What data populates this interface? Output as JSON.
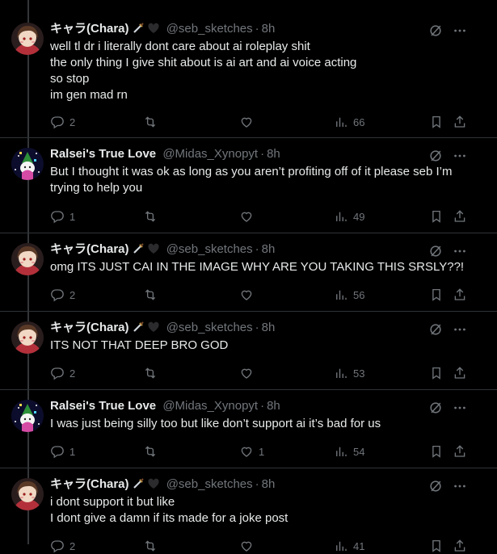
{
  "colors": {
    "background": "#000000",
    "text": "#e7e9ea",
    "muted": "#71767b",
    "divider": "#2f3336"
  },
  "tweets": [
    {
      "name": "キャラ(Chara)",
      "badges": [
        "dagger-emoji",
        "black-heart-emoji"
      ],
      "handle": "@seb_sketches",
      "dot": "·",
      "time": "8h",
      "avatar": "chara-avatar",
      "lines": [
        "well tl dr i literally dont care about ai roleplay shit",
        "the only thing I give shit about is ai art and ai voice acting",
        "so stop",
        "im gen mad rn"
      ],
      "replies": "2",
      "reposts": "",
      "likes": "",
      "views": "66"
    },
    {
      "name": "Ralsei's True Love",
      "badges": [],
      "handle": "@Midas_Xynopyt",
      "dot": "·",
      "time": "8h",
      "avatar": "ralsei-avatar",
      "lines": [
        "But I thought it was ok as long as you aren’t profiting off of it please seb I’m",
        "trying to help you"
      ],
      "replies": "1",
      "reposts": "",
      "likes": "",
      "views": "49"
    },
    {
      "name": "キャラ(Chara)",
      "badges": [
        "dagger-emoji",
        "black-heart-emoji"
      ],
      "handle": "@seb_sketches",
      "dot": "·",
      "time": "8h",
      "avatar": "chara-avatar",
      "lines": [
        "omg ITS JUST CAI IN THE IMAGE WHY ARE YOU TAKING THIS SRSLY??!"
      ],
      "replies": "2",
      "reposts": "",
      "likes": "",
      "views": "56"
    },
    {
      "name": "キャラ(Chara)",
      "badges": [
        "dagger-emoji",
        "black-heart-emoji"
      ],
      "handle": "@seb_sketches",
      "dot": "·",
      "time": "8h",
      "avatar": "chara-avatar",
      "lines": [
        "ITS NOT THAT DEEP BRO GOD"
      ],
      "replies": "2",
      "reposts": "",
      "likes": "",
      "views": "53"
    },
    {
      "name": "Ralsei's True Love",
      "badges": [],
      "handle": "@Midas_Xynopyt",
      "dot": "·",
      "time": "8h",
      "avatar": "ralsei-avatar",
      "lines": [
        "I was just being silly too but like don’t support ai it’s bad for us"
      ],
      "replies": "1",
      "reposts": "",
      "likes": "1",
      "views": "54"
    },
    {
      "name": "キャラ(Chara)",
      "badges": [
        "dagger-emoji",
        "black-heart-emoji"
      ],
      "handle": "@seb_sketches",
      "dot": "·",
      "time": "8h",
      "avatar": "chara-avatar",
      "lines": [
        "i dont support it but like",
        "I dont give a damn if its made for a joke post"
      ],
      "replies": "2",
      "reposts": "",
      "likes": "",
      "views": "41"
    }
  ]
}
